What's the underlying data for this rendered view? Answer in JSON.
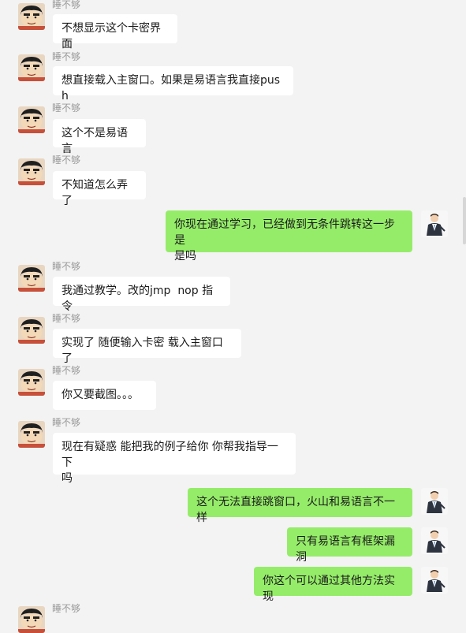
{
  "sender_name": "睡不够",
  "messages": [
    {
      "dir": "in",
      "text": "不想显示这个卡密界面"
    },
    {
      "dir": "in",
      "text": "想直接载入主窗口。如果是易语言我直接push"
    },
    {
      "dir": "in",
      "text": "这个不是易语言"
    },
    {
      "dir": "in",
      "text": "不知道怎么弄了"
    },
    {
      "dir": "out",
      "text": "你现在通过学习，已经做到无条件跳转这一步是\n是吗"
    },
    {
      "dir": "in",
      "text": "我通过教学。改的jmp  nop 指令"
    },
    {
      "dir": "in",
      "text": "实现了 随便输入卡密 载入主窗口了"
    },
    {
      "dir": "in",
      "text": "你又要截图。。。"
    },
    {
      "dir": "in",
      "text": "现在有疑惑 能把我的例子给你 你帮我指导一下\n吗"
    },
    {
      "dir": "out",
      "text": "这个无法直接跳窗口，火山和易语言不一样"
    },
    {
      "dir": "out",
      "text": "只有易语言有框架漏洞"
    },
    {
      "dir": "out",
      "text": "你这个可以通过其他方法实现"
    },
    {
      "dir": "in",
      "text": ""
    }
  ]
}
